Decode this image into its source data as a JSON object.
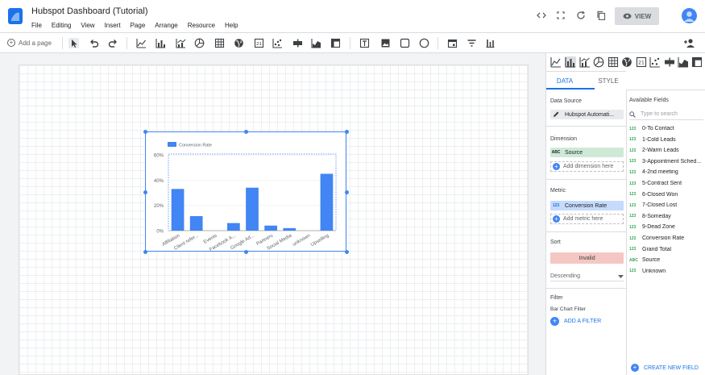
{
  "app": {
    "title": "Hubspot Dashboard (Tutorial)"
  },
  "menu": [
    "File",
    "Editing",
    "View",
    "Insert",
    "Page",
    "Arrange",
    "Resource",
    "Help"
  ],
  "header": {
    "view_label": "VIEW"
  },
  "toolbar": {
    "add_page_label": "Add a page"
  },
  "chart_data": {
    "type": "bar",
    "categories": [
      "Affiliation",
      "Client refer...",
      "Events",
      "Facebook A...",
      "Google Ad...",
      "Partners",
      "Social Media",
      "unknown",
      "Upselling"
    ],
    "series": [
      {
        "name": "Conversion Rate",
        "values": [
          33,
          11.5,
          0,
          6,
          34,
          4,
          2,
          0,
          45
        ]
      }
    ],
    "ylim": [
      0,
      60
    ],
    "yticks": [
      "0%",
      "20%",
      "40%",
      "60%"
    ],
    "ytick_values": [
      0,
      20,
      40,
      60
    ],
    "colors": {
      "bar": "#4285f4"
    },
    "legend_placement": "top-left"
  },
  "panel": {
    "tabs": [
      "DATA",
      "STYLE"
    ],
    "data_source_label": "Data Source",
    "data_source_value": "Hubspot Automati...",
    "dimension_label": "Dimension",
    "dimension_chip": "Source",
    "dimension_type": "ABC",
    "add_dimension": "Add dimension here",
    "metric_label": "Metric",
    "metric_chip": "Conversion Rate",
    "metric_type": "123",
    "add_metric": "Add metric here",
    "sort_label": "Sort",
    "sort_invalid": "Invalid",
    "sort_order": "Descending",
    "filter_label": "Filter",
    "filter_sub": "Bar Chart Filter",
    "add_filter": "ADD A FILTER"
  },
  "fields": {
    "title": "Available Fields",
    "search_placeholder": "Type to search",
    "items": [
      {
        "type": "123",
        "name": "0-To Contact"
      },
      {
        "type": "123",
        "name": "1-Cold Leads"
      },
      {
        "type": "123",
        "name": "2-Warm Leads"
      },
      {
        "type": "123",
        "name": "3-Appointment Sched..."
      },
      {
        "type": "123",
        "name": "4-2nd meeting"
      },
      {
        "type": "123",
        "name": "5-Contract Sent"
      },
      {
        "type": "123",
        "name": "6-Closed Won"
      },
      {
        "type": "123",
        "name": "7-Closed Lost"
      },
      {
        "type": "123",
        "name": "8-Someday"
      },
      {
        "type": "123",
        "name": "9-Dead Zone"
      },
      {
        "type": "123",
        "name": "Conversion Rate"
      },
      {
        "type": "123",
        "name": "Grand Total"
      },
      {
        "type": "ABC",
        "name": "Source"
      },
      {
        "type": "123",
        "name": "Unknown"
      }
    ],
    "create_new": "CREATE NEW FIELD"
  }
}
